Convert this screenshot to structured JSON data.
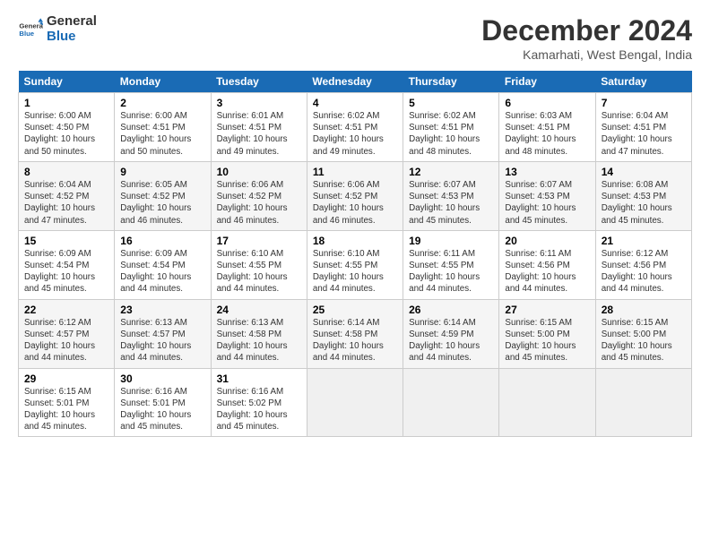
{
  "header": {
    "logo_general": "General",
    "logo_blue": "Blue",
    "title": "December 2024",
    "location": "Kamarhati, West Bengal, India"
  },
  "weekdays": [
    "Sunday",
    "Monday",
    "Tuesday",
    "Wednesday",
    "Thursday",
    "Friday",
    "Saturday"
  ],
  "weeks": [
    [
      {
        "day": "1",
        "info": "Sunrise: 6:00 AM\nSunset: 4:50 PM\nDaylight: 10 hours\nand 50 minutes."
      },
      {
        "day": "2",
        "info": "Sunrise: 6:00 AM\nSunset: 4:51 PM\nDaylight: 10 hours\nand 50 minutes."
      },
      {
        "day": "3",
        "info": "Sunrise: 6:01 AM\nSunset: 4:51 PM\nDaylight: 10 hours\nand 49 minutes."
      },
      {
        "day": "4",
        "info": "Sunrise: 6:02 AM\nSunset: 4:51 PM\nDaylight: 10 hours\nand 49 minutes."
      },
      {
        "day": "5",
        "info": "Sunrise: 6:02 AM\nSunset: 4:51 PM\nDaylight: 10 hours\nand 48 minutes."
      },
      {
        "day": "6",
        "info": "Sunrise: 6:03 AM\nSunset: 4:51 PM\nDaylight: 10 hours\nand 48 minutes."
      },
      {
        "day": "7",
        "info": "Sunrise: 6:04 AM\nSunset: 4:51 PM\nDaylight: 10 hours\nand 47 minutes."
      }
    ],
    [
      {
        "day": "8",
        "info": "Sunrise: 6:04 AM\nSunset: 4:52 PM\nDaylight: 10 hours\nand 47 minutes."
      },
      {
        "day": "9",
        "info": "Sunrise: 6:05 AM\nSunset: 4:52 PM\nDaylight: 10 hours\nand 46 minutes."
      },
      {
        "day": "10",
        "info": "Sunrise: 6:06 AM\nSunset: 4:52 PM\nDaylight: 10 hours\nand 46 minutes."
      },
      {
        "day": "11",
        "info": "Sunrise: 6:06 AM\nSunset: 4:52 PM\nDaylight: 10 hours\nand 46 minutes."
      },
      {
        "day": "12",
        "info": "Sunrise: 6:07 AM\nSunset: 4:53 PM\nDaylight: 10 hours\nand 45 minutes."
      },
      {
        "day": "13",
        "info": "Sunrise: 6:07 AM\nSunset: 4:53 PM\nDaylight: 10 hours\nand 45 minutes."
      },
      {
        "day": "14",
        "info": "Sunrise: 6:08 AM\nSunset: 4:53 PM\nDaylight: 10 hours\nand 45 minutes."
      }
    ],
    [
      {
        "day": "15",
        "info": "Sunrise: 6:09 AM\nSunset: 4:54 PM\nDaylight: 10 hours\nand 45 minutes."
      },
      {
        "day": "16",
        "info": "Sunrise: 6:09 AM\nSunset: 4:54 PM\nDaylight: 10 hours\nand 44 minutes."
      },
      {
        "day": "17",
        "info": "Sunrise: 6:10 AM\nSunset: 4:55 PM\nDaylight: 10 hours\nand 44 minutes."
      },
      {
        "day": "18",
        "info": "Sunrise: 6:10 AM\nSunset: 4:55 PM\nDaylight: 10 hours\nand 44 minutes."
      },
      {
        "day": "19",
        "info": "Sunrise: 6:11 AM\nSunset: 4:55 PM\nDaylight: 10 hours\nand 44 minutes."
      },
      {
        "day": "20",
        "info": "Sunrise: 6:11 AM\nSunset: 4:56 PM\nDaylight: 10 hours\nand 44 minutes."
      },
      {
        "day": "21",
        "info": "Sunrise: 6:12 AM\nSunset: 4:56 PM\nDaylight: 10 hours\nand 44 minutes."
      }
    ],
    [
      {
        "day": "22",
        "info": "Sunrise: 6:12 AM\nSunset: 4:57 PM\nDaylight: 10 hours\nand 44 minutes."
      },
      {
        "day": "23",
        "info": "Sunrise: 6:13 AM\nSunset: 4:57 PM\nDaylight: 10 hours\nand 44 minutes."
      },
      {
        "day": "24",
        "info": "Sunrise: 6:13 AM\nSunset: 4:58 PM\nDaylight: 10 hours\nand 44 minutes."
      },
      {
        "day": "25",
        "info": "Sunrise: 6:14 AM\nSunset: 4:58 PM\nDaylight: 10 hours\nand 44 minutes."
      },
      {
        "day": "26",
        "info": "Sunrise: 6:14 AM\nSunset: 4:59 PM\nDaylight: 10 hours\nand 44 minutes."
      },
      {
        "day": "27",
        "info": "Sunrise: 6:15 AM\nSunset: 5:00 PM\nDaylight: 10 hours\nand 45 minutes."
      },
      {
        "day": "28",
        "info": "Sunrise: 6:15 AM\nSunset: 5:00 PM\nDaylight: 10 hours\nand 45 minutes."
      }
    ],
    [
      {
        "day": "29",
        "info": "Sunrise: 6:15 AM\nSunset: 5:01 PM\nDaylight: 10 hours\nand 45 minutes."
      },
      {
        "day": "30",
        "info": "Sunrise: 6:16 AM\nSunset: 5:01 PM\nDaylight: 10 hours\nand 45 minutes."
      },
      {
        "day": "31",
        "info": "Sunrise: 6:16 AM\nSunset: 5:02 PM\nDaylight: 10 hours\nand 45 minutes."
      },
      null,
      null,
      null,
      null
    ]
  ]
}
